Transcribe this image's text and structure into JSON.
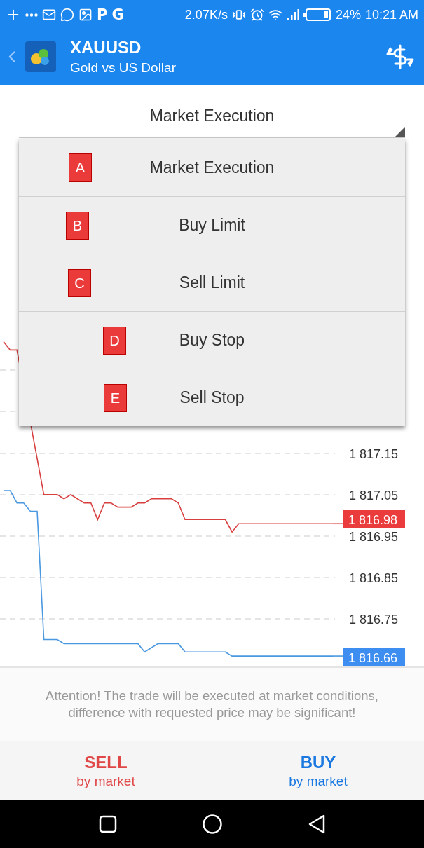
{
  "status_bar": {
    "app_glyphs": [
      "P",
      "G"
    ],
    "network_speed": "2.07K/s",
    "battery": "24%",
    "time": "10:21 AM"
  },
  "header": {
    "symbol": "XAUUSD",
    "description": "Gold vs US Dollar"
  },
  "order_type": {
    "value": "Market Execution",
    "expanded": true,
    "options": [
      {
        "label": "Market Execution",
        "marker": "A"
      },
      {
        "label": "Buy Limit",
        "marker": "B"
      },
      {
        "label": "Sell Limit",
        "marker": "C"
      },
      {
        "label": "Buy Stop",
        "marker": "D"
      },
      {
        "label": "Sell Stop",
        "marker": "E"
      }
    ]
  },
  "chart": {
    "ask_price": "1 816.98",
    "bid_price": "1 816.66",
    "chart_data": {
      "type": "line",
      "grid": true,
      "ylim": [
        1816.633,
        1818.043
      ],
      "categories": [
        null,
        null,
        null,
        null,
        null,
        null,
        null,
        null,
        null,
        null,
        null,
        null,
        null,
        null,
        null,
        null,
        null,
        null,
        null,
        null,
        null,
        null,
        null,
        null,
        null,
        null,
        null,
        null,
        null,
        null,
        null,
        null,
        null,
        null,
        null,
        null,
        null,
        null,
        null,
        null,
        null,
        null,
        null,
        null,
        null,
        null,
        null,
        null,
        null,
        null
      ],
      "yticks": [
        {
          "value": 1817.15,
          "label": "1 817.15"
        },
        {
          "value": 1817.05,
          "label": "1 817.05"
        },
        {
          "value": 1816.95,
          "label": "1 816.95"
        },
        {
          "value": 1816.85,
          "label": "1 816.85"
        },
        {
          "value": 1816.75,
          "label": "1 816.75"
        }
      ],
      "series": [
        {
          "color": "#d84040",
          "values": [
            1817.42,
            1817.4,
            1817.4,
            null,
            null,
            null,
            1817.05,
            1817.05,
            1817.05,
            1817.04,
            1817.05,
            1817.04,
            1817.03,
            1817.03,
            1816.99,
            1817.03,
            1817.03,
            1817.02,
            1817.02,
            1817.02,
            1817.03,
            1817.03,
            1817.04,
            1817.04,
            1817.04,
            1817.04,
            1817.03,
            1816.99,
            1816.99,
            1816.99,
            1816.99,
            1816.99,
            1816.99,
            1816.99,
            1816.96,
            1816.98,
            1816.98,
            1816.98,
            1816.98,
            1816.98,
            1816.98,
            1816.98,
            1816.98,
            1816.98,
            1816.98,
            1816.98,
            1816.98,
            1816.98,
            1816.98,
            1816.98
          ]
        },
        {
          "color": "#4a98e0",
          "values": [
            1817.06,
            1817.06,
            1817.03,
            1817.03,
            1817.01,
            1817.01,
            1816.7,
            1816.7,
            1816.7,
            1816.69,
            1816.69,
            1816.69,
            1816.69,
            1816.69,
            1816.69,
            1816.69,
            1816.69,
            1816.69,
            1816.69,
            1816.69,
            1816.69,
            1816.67,
            1816.68,
            1816.69,
            1816.69,
            1816.69,
            1816.69,
            1816.67,
            1816.67,
            1816.67,
            1816.67,
            1816.67,
            1816.67,
            1816.67,
            1816.66,
            1816.66,
            1816.66,
            1816.66,
            1816.66,
            1816.66,
            1816.66,
            1816.66,
            1816.66,
            1816.66,
            1816.66,
            1816.66,
            1816.66,
            1816.66,
            1816.66,
            1816.66
          ]
        }
      ]
    }
  },
  "notice": "Attention! The trade will be executed at market conditions, difference with requested price may be significant!",
  "buttons": [
    {
      "kind": "sell",
      "label": "SELL",
      "sublabel": "by market"
    },
    {
      "kind": "buy",
      "label": "BUY",
      "sublabel": "by market"
    }
  ]
}
